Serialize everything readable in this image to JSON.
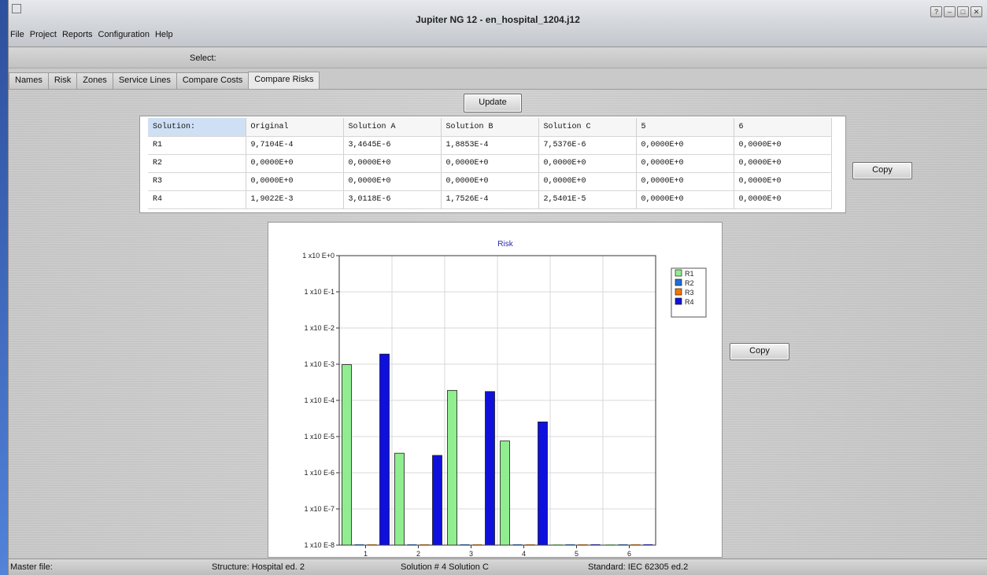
{
  "app": {
    "title": "Jupiter NG 12 - en_hospital_1204.j12",
    "menu": [
      "File",
      "Project",
      "Reports",
      "Configuration",
      "Help"
    ],
    "select_label": "Select:"
  },
  "tabs": [
    "Names",
    "Risk",
    "Zones",
    "Service Lines",
    "Compare Costs",
    "Compare Risks"
  ],
  "active_tab": "Compare Risks",
  "buttons": {
    "update": "Update",
    "copy_table": "Copy",
    "copy_chart": "Copy"
  },
  "table": {
    "headers": [
      "Solution:",
      "Original",
      "Solution A",
      "Solution B",
      "Solution C",
      "5",
      "6"
    ],
    "rows": [
      [
        "R1",
        "9,7104E-4",
        "3,4645E-6",
        "1,8853E-4",
        "7,5376E-6",
        "0,0000E+0",
        "0,0000E+0"
      ],
      [
        "R2",
        "0,0000E+0",
        "0,0000E+0",
        "0,0000E+0",
        "0,0000E+0",
        "0,0000E+0",
        "0,0000E+0"
      ],
      [
        "R3",
        "0,0000E+0",
        "0,0000E+0",
        "0,0000E+0",
        "0,0000E+0",
        "0,0000E+0",
        "0,0000E+0"
      ],
      [
        "R4",
        "1,9022E-3",
        "3,0118E-6",
        "1,7526E-4",
        "2,5401E-5",
        "0,0000E+0",
        "0,0000E+0"
      ]
    ]
  },
  "chart_data": {
    "type": "bar",
    "title": "Risk",
    "xlabel": "",
    "ylabel": "",
    "y_scale": "log",
    "ylim": [
      1e-08,
      1
    ],
    "y_ticks": [
      "1 x10 E+0",
      "1 x10 E-1",
      "1 x10 E-2",
      "1 x10 E-3",
      "1 x10 E-4",
      "1 x10 E-5",
      "1 x10 E-6",
      "1 x10 E-7",
      "1 x10 E-8"
    ],
    "categories": [
      "1",
      "2",
      "3",
      "4",
      "5",
      "6"
    ],
    "series": [
      {
        "name": "R1",
        "color": "#90ee90",
        "values": [
          0.00097104,
          3.4645e-06,
          0.00018853,
          7.5376e-06,
          0,
          0
        ]
      },
      {
        "name": "R2",
        "color": "#1e6ed6",
        "values": [
          0,
          0,
          0,
          0,
          0,
          0
        ]
      },
      {
        "name": "R3",
        "color": "#f07800",
        "values": [
          0,
          0,
          0,
          0,
          0,
          0
        ]
      },
      {
        "name": "R4",
        "color": "#1010dd",
        "values": [
          0.0019022,
          3.0118e-06,
          0.00017526,
          2.5401e-05,
          0,
          0
        ]
      }
    ],
    "grid": true,
    "legend_position": "top-right"
  },
  "status": {
    "master_file": "Master file:",
    "structure": "Structure: Hospital ed. 2",
    "solution": "Solution # 4 Solution C",
    "standard": "Standard: IEC 62305 ed.2"
  }
}
